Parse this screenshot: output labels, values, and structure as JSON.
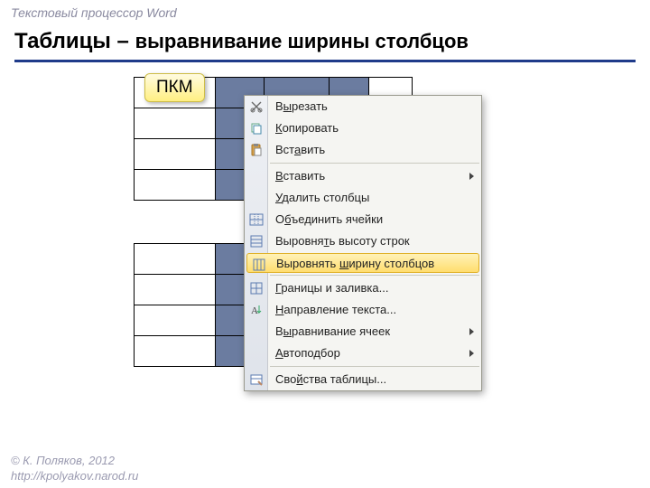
{
  "header": {
    "sub": "Текстовый процессор Word"
  },
  "title": {
    "part1": "Таблицы",
    "dash": " – ",
    "part2": "выравнивание ширины столбцов"
  },
  "callout": "ПКМ",
  "menu": {
    "cut": {
      "pre": "В",
      "u": "ы",
      "post": "резать"
    },
    "copy": {
      "pre": "",
      "u": "К",
      "post": "опировать"
    },
    "paste": {
      "pre": "Вст",
      "u": "а",
      "post": "вить"
    },
    "insert": {
      "pre": "",
      "u": "В",
      "post": "ставить"
    },
    "delcols": {
      "pre": "",
      "u": "У",
      "post": "далить столбцы"
    },
    "merge": {
      "pre": "О",
      "u": "б",
      "post": "ъединить ячейки"
    },
    "distrows": {
      "pre": "Выровня",
      "u": "т",
      "post": "ь высоту строк"
    },
    "distcols": {
      "pre": "Выровнять ",
      "u": "ш",
      "post": "ирину столбцов"
    },
    "borders": {
      "pre": "",
      "u": "Г",
      "post": "раницы и заливка..."
    },
    "textdir": {
      "pre": "",
      "u": "Н",
      "post": "аправление текста..."
    },
    "align": {
      "pre": "В",
      "u": "ы",
      "post": "равнивание ячеек"
    },
    "autofit": {
      "pre": "",
      "u": "А",
      "post": "втоподбор"
    },
    "props": {
      "pre": "Сво",
      "u": "й",
      "post": "ства таблицы..."
    }
  },
  "footer": {
    "l1": "© К. Поляков, 2012",
    "l2": "http://kpolyakov.narod.ru"
  }
}
